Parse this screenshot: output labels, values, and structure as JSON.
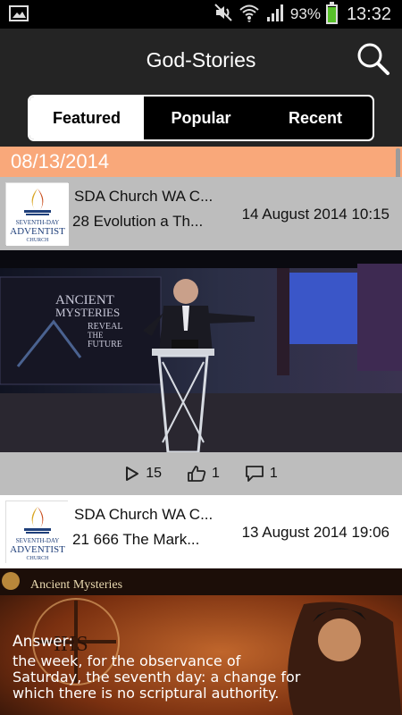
{
  "status_bar": {
    "battery": "93%",
    "battery_level": 0.93,
    "time": "13:32",
    "icons": [
      "image-icon",
      "mute-icon",
      "wifi-icon",
      "signal-icon",
      "battery-icon"
    ]
  },
  "app_bar": {
    "title": "God-Stories",
    "search_icon": "search-icon"
  },
  "tabs": [
    {
      "label": "Featured",
      "active": true
    },
    {
      "label": "Popular",
      "active": false
    },
    {
      "label": "Recent",
      "active": false
    }
  ],
  "feed": {
    "date_header": "08/13/2014",
    "posts": [
      {
        "channel": "SDA Church WA C...",
        "title": "28 Evolution a Th...",
        "date": "14 August 2014 10:15",
        "avatar_logo": {
          "line1": "SEVENTH-DAY",
          "line2": "ADVENTIST",
          "line3": "CHURCH"
        },
        "thumbnail_text": {
          "line1": "ANCIENT",
          "line2": "MYSTERIES",
          "line3": "REVEAL",
          "line4": "THE",
          "line5": "FUTURE"
        },
        "plays": "15",
        "likes": "1",
        "comments": "1"
      },
      {
        "channel": "SDA Church WA C...",
        "title": "21 666 The Mark...",
        "date": "13 August 2014 19:06",
        "avatar_logo": {
          "line1": "SEVENTH-DAY",
          "line2": "ADVENTIST",
          "line3": "CHURCH"
        },
        "thumbnail_text": {
          "banner": "Ancient Mysteries",
          "answer_label": "Answer:",
          "line1": "the week, for the observance of",
          "line2": "Saturday, the seventh day: a change for",
          "line3": "which there is no scriptural authority.",
          "seal": "IHS"
        }
      }
    ]
  },
  "colors": {
    "app_bar": "#242424",
    "date_header": "#f9a87a",
    "post_grey": "#bdbdbd",
    "battery_green": "#58c12a"
  }
}
